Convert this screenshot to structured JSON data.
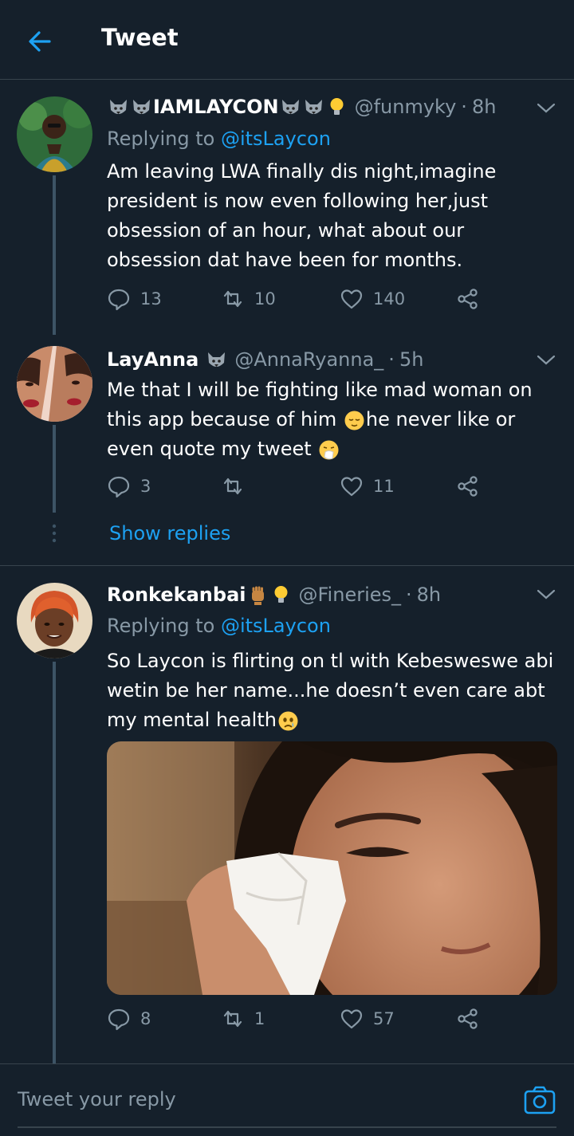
{
  "header": {
    "title": "Tweet"
  },
  "tweets": [
    {
      "name": "IAMLAYCON",
      "name_prefix_emoji": [
        "wolf-emoji",
        "wolf-emoji"
      ],
      "name_suffix_emoji": [
        "wolf-emoji",
        "wolf-emoji",
        "lightbulb-emoji"
      ],
      "handle": "@funmyky",
      "time": "8h",
      "replying_label": "Replying to",
      "replying_to": "@itsLaycon",
      "text": "Am leaving LWA finally dis night,imagine president is now even following her,just obsession of an hour, what about our obsession dat have been for months.",
      "replies": "13",
      "retweets": "10",
      "likes": "140"
    },
    {
      "name": "LayAnna",
      "name_suffix_emoji": [
        "wolf-emoji"
      ],
      "handle": "@AnnaRyanna_",
      "time": "5h",
      "text_part1": "Me that I will be fighting like mad woman on this app because of him ",
      "text_part2": "he never like or even quote my tweet ",
      "text_emoji1": "relieved-face-emoji",
      "text_emoji2": "sneezing-face-emoji",
      "replies": "3",
      "retweets": "",
      "likes": "11",
      "show_replies": "Show replies"
    },
    {
      "name": "Ronkekanbai",
      "name_suffix_emoji": [
        "raised-fist-emoji",
        "lightbulb-emoji"
      ],
      "handle": "@Fineries_",
      "time": "8h",
      "replying_label": "Replying to",
      "replying_to": "@itsLaycon",
      "text": "So Laycon is flirting on tl with Kebesweswe abi wetin be her name...he doesn’t even care abt my mental health",
      "text_emoji": "crying-face-emoji",
      "replies": "8",
      "retweets": "1",
      "likes": "57"
    }
  ],
  "reply_bar": {
    "placeholder": "Tweet your reply"
  },
  "colors": {
    "background": "#15202b",
    "accent": "#1da1f2",
    "secondary_text": "#8899a6",
    "divider": "#38444d"
  }
}
